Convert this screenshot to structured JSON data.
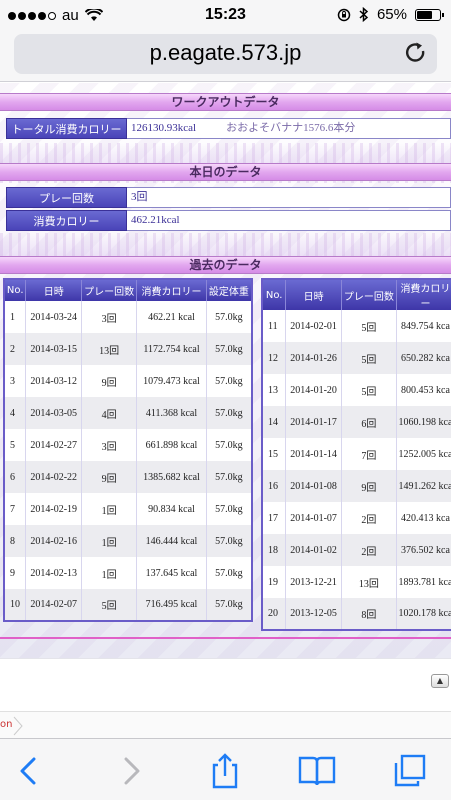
{
  "status_bar": {
    "carrier": "au",
    "time": "15:23",
    "battery": "65%"
  },
  "browser": {
    "url": "p.eagate.573.jp"
  },
  "workout": {
    "heading": "ワークアウトデータ",
    "total_calories_label": "トータル消費カロリー",
    "total_calories_value": "126130.93kcal",
    "banana_note": "おおよそバナナ1576.6本分"
  },
  "today": {
    "heading": "本日のデータ",
    "plays_label": "プレー回数",
    "plays_value": "3回",
    "calories_label": "消費カロリー",
    "calories_value": "462.21kcal"
  },
  "past": {
    "heading": "過去のデータ",
    "headers": {
      "no": "No.",
      "date": "日時",
      "plays": "プレー回数",
      "calories": "消費カロリー",
      "weight": "設定体重"
    },
    "left_rows": [
      {
        "no": "1",
        "date": "2014-03-24",
        "plays": "3回",
        "calories": "462.21 kcal",
        "weight": "57.0kg"
      },
      {
        "no": "2",
        "date": "2014-03-15",
        "plays": "13回",
        "calories": "1172.754 kcal",
        "weight": "57.0kg"
      },
      {
        "no": "3",
        "date": "2014-03-12",
        "plays": "9回",
        "calories": "1079.473 kcal",
        "weight": "57.0kg"
      },
      {
        "no": "4",
        "date": "2014-03-05",
        "plays": "4回",
        "calories": "411.368 kcal",
        "weight": "57.0kg"
      },
      {
        "no": "5",
        "date": "2014-02-27",
        "plays": "3回",
        "calories": "661.898 kcal",
        "weight": "57.0kg"
      },
      {
        "no": "6",
        "date": "2014-02-22",
        "plays": "9回",
        "calories": "1385.682 kcal",
        "weight": "57.0kg"
      },
      {
        "no": "7",
        "date": "2014-02-19",
        "plays": "1回",
        "calories": "90.834 kcal",
        "weight": "57.0kg"
      },
      {
        "no": "8",
        "date": "2014-02-16",
        "plays": "1回",
        "calories": "146.444 kcal",
        "weight": "57.0kg"
      },
      {
        "no": "9",
        "date": "2014-02-13",
        "plays": "1回",
        "calories": "137.645 kcal",
        "weight": "57.0kg"
      },
      {
        "no": "10",
        "date": "2014-02-07",
        "plays": "5回",
        "calories": "716.495 kcal",
        "weight": "57.0kg"
      }
    ],
    "right_rows": [
      {
        "no": "11",
        "date": "2014-02-01",
        "plays": "5回",
        "calories": "849.754 kca"
      },
      {
        "no": "12",
        "date": "2014-01-26",
        "plays": "5回",
        "calories": "650.282 kca"
      },
      {
        "no": "13",
        "date": "2014-01-20",
        "plays": "5回",
        "calories": "800.453 kca"
      },
      {
        "no": "14",
        "date": "2014-01-17",
        "plays": "6回",
        "calories": "1060.198 kca"
      },
      {
        "no": "15",
        "date": "2014-01-14",
        "plays": "7回",
        "calories": "1252.005 kca"
      },
      {
        "no": "16",
        "date": "2014-01-08",
        "plays": "9回",
        "calories": "1491.262 kca"
      },
      {
        "no": "17",
        "date": "2014-01-07",
        "plays": "2回",
        "calories": "420.413 kca"
      },
      {
        "no": "18",
        "date": "2014-01-02",
        "plays": "2回",
        "calories": "376.502 kca"
      },
      {
        "no": "19",
        "date": "2013-12-21",
        "plays": "13回",
        "calories": "1893.781 kca"
      },
      {
        "no": "20",
        "date": "2013-12-05",
        "plays": "8回",
        "calories": "1020.178 kca"
      }
    ],
    "right_calories_header": "消費カロリー"
  },
  "footer": {
    "up_button": "▲",
    "breadcrumb": "on"
  },
  "icons": {
    "back": "chevron-left-icon",
    "forward": "chevron-right-icon",
    "share": "share-icon",
    "bookmarks": "book-icon",
    "tabs": "tabs-icon",
    "reload": "reload-icon"
  },
  "colors": {
    "accent": "#1e7cf5",
    "header": "#4a44b8",
    "section": "#e2a7ef"
  }
}
